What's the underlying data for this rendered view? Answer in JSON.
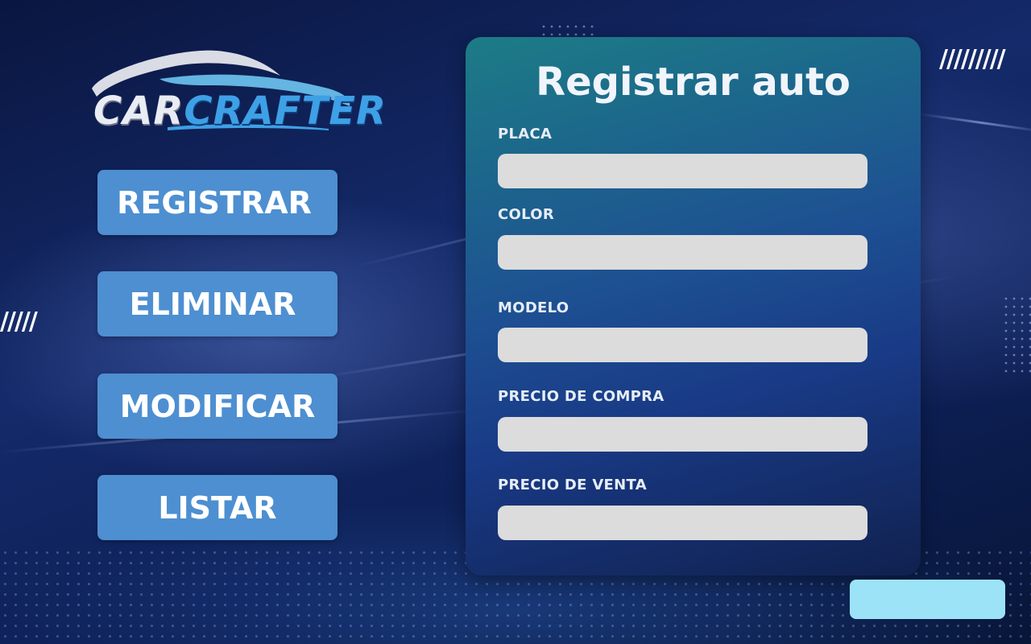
{
  "logo": {
    "part1": "CAR",
    "part2": "CRAFTER"
  },
  "menu": {
    "items": [
      {
        "label": "REGISTRAR"
      },
      {
        "label": "ELIMINAR"
      },
      {
        "label": "MODIFICAR"
      },
      {
        "label": "LISTAR"
      }
    ]
  },
  "form": {
    "title": "Registrar auto",
    "fields": [
      {
        "label": "PLACA",
        "value": "",
        "placeholder": ""
      },
      {
        "label": "COLOR",
        "value": "",
        "placeholder": ""
      },
      {
        "label": "MODELO",
        "value": "",
        "placeholder": ""
      },
      {
        "label": "PRECIO DE COMPRA",
        "value": "",
        "placeholder": ""
      },
      {
        "label": "PRECIO DE VENTA",
        "value": "",
        "placeholder": ""
      }
    ],
    "submit_label": ""
  },
  "colors": {
    "menu_button": "#4d8fd1",
    "input_background": "#dcdcdc",
    "submit_button": "#9ce3f7",
    "logo_accent": "#3ea0e6"
  }
}
